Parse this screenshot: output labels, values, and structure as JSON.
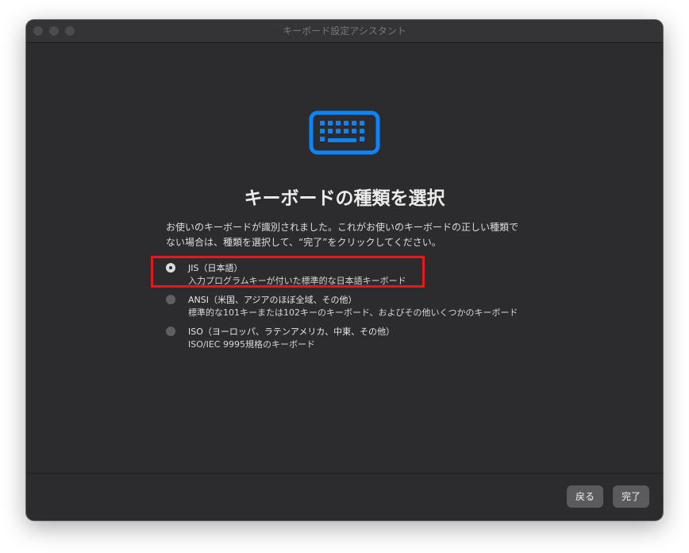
{
  "window": {
    "title": "キーボード設定アシスタント"
  },
  "main": {
    "icon": "keyboard-icon",
    "heading": "キーボードの種類を選択",
    "description_line1": "お使いのキーボードが識別されました。これがお使いのキーボードの正しい種類で",
    "description_line2": "ない場合は、種類を選択して、“完了”をクリックしてください。",
    "options": [
      {
        "label": "JIS（日本語）",
        "sub": "入力プログラムキーが付いた標準的な日本語キーボード",
        "selected": true
      },
      {
        "label": "ANSI（米国、アジアのほぼ全域、その他）",
        "sub": "標準的な101キーまたは102キーのキーボード、およびその他いくつかのキーボード",
        "selected": false
      },
      {
        "label": "ISO（ヨーロッパ、ラテンアメリカ、中東、その他）",
        "sub": "ISO/IEC 9995規格のキーボード",
        "selected": false
      }
    ]
  },
  "footer": {
    "back_label": "戻る",
    "done_label": "完了"
  },
  "colors": {
    "accent": "#0a84ff",
    "highlight": "#e11b1b",
    "window_bg": "#2c2c2e"
  }
}
